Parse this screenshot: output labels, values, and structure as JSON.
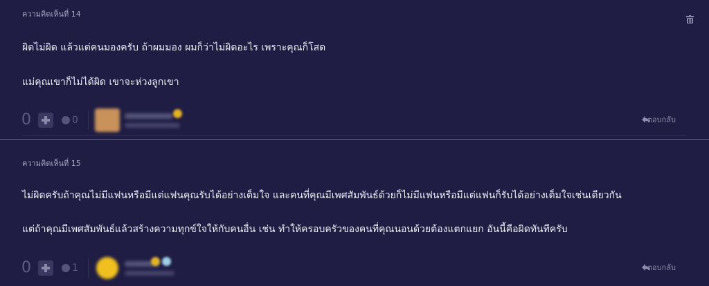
{
  "comments": [
    {
      "header": "ความคิดเห็นที่ 14",
      "lines": [
        "ผิดไม่ผิด แล้วแต่คนมองครับ ถ้าผมมอง ผมก็ว่าไม่ผิดอะไร เพราะคุณก็โสด",
        "แม่คุณเขาก็ไม่ได้ผิด เขาจะห่วงลูกเขา"
      ],
      "votes": "0",
      "emoji_count": "0",
      "reply_label": "ตอบกลับ",
      "avatar_color": "#c9925a",
      "badge_color": "#e2b324"
    },
    {
      "header": "ความคิดเห็นที่ 15",
      "lines": [
        "ไม่ผิดครับถ้าคุณไม่มีแฟนหรือมีแต่แฟนคุณรับได้อย่างเต็มใจ และคนที่คุณมีเพศสัมพันธ์ด้วยก็ไม่มีแฟนหรือมีแต่แฟนก็รับได้อย่างเต็มใจเช่นเดียวกัน",
        "แต่ถ้าคุณมีเพศสัมพันธ์แล้วสร้างความทุกข์ใจให้กับคนอื่น เช่น ทำให้ครอบครัวของคนที่คุณนอนด้วยต้องแตกแยก อันนี้คือผิดทันทีครับ"
      ],
      "votes": "0",
      "emoji_count": "1",
      "reply_label": "ตอบกลับ",
      "avatar_color": "#f0c020",
      "badge_color": "#e2b324"
    }
  ],
  "colors": {
    "background": "#1f1d44",
    "divider": "#6c6a8c",
    "text": "#ececf4",
    "muted": "#5f5d82"
  },
  "icons": [
    "trash-icon",
    "plus-icon",
    "emoji-icon",
    "reply-arrow-icon"
  ]
}
